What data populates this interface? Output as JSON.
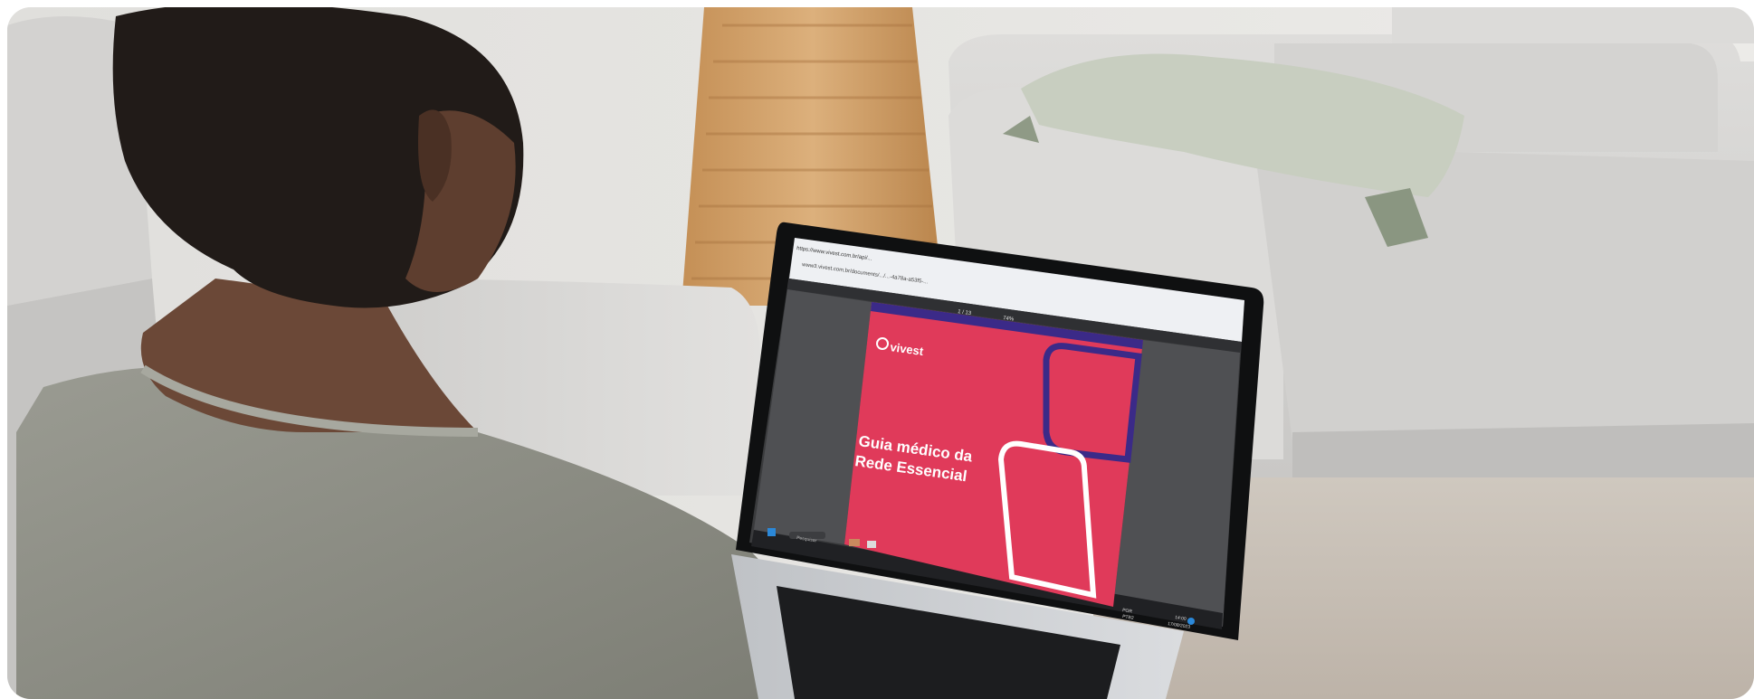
{
  "scene": {
    "colors": {
      "wall": "#e7e5e2",
      "sofa": "#d9d8d6",
      "floor": "#c9c1b8",
      "lamp": "#d3a36a",
      "pillow": "#c9cfc2",
      "shirt": "#8e8f86",
      "skin": "#6b4837",
      "hair": "#1f1a17",
      "laptop_body": "#cfd1d4",
      "screen_bg": "#3a3b3d",
      "cover": "#e03a5a",
      "cover_line_dark": "#3b2a88",
      "cover_line_light": "#ffffff"
    }
  },
  "browser": {
    "tab_title": "https://www.vivest.com.br/api/...",
    "address": "www3.vivest.com.br/documents/.../...-4a78a-a53f5-...",
    "page_counter": "1 / 13",
    "zoom": "74%"
  },
  "document": {
    "brand": "vivest",
    "title_line1": "Guia médico da",
    "title_line2": "Rede Essencial"
  },
  "taskbar": {
    "search_placeholder": "Pesquisar",
    "lang_line1": "POR",
    "lang_line2": "PTB2",
    "time": "14:00",
    "date": "17/08/2023"
  }
}
